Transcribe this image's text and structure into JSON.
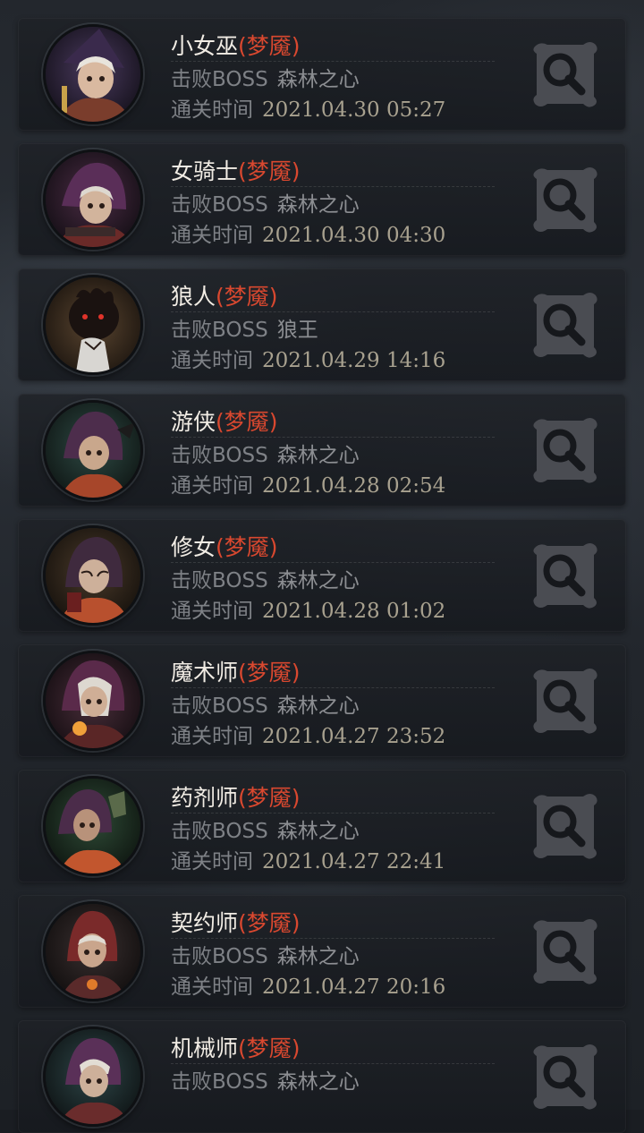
{
  "difficulty_label": "(梦魇)",
  "boss_label": "击败BOSS",
  "time_label": "通关时间",
  "records": [
    {
      "character": "小女巫",
      "boss": "森林之心",
      "time": "2021.04.30 05:27",
      "portrait": "little-witch-portrait"
    },
    {
      "character": "女骑士",
      "boss": "森林之心",
      "time": "2021.04.30 04:30",
      "portrait": "female-knight-portrait"
    },
    {
      "character": "狼人",
      "boss": "狼王",
      "time": "2021.04.29 14:16",
      "portrait": "werewolf-portrait"
    },
    {
      "character": "游侠",
      "boss": "森林之心",
      "time": "2021.04.28 02:54",
      "portrait": "ranger-portrait"
    },
    {
      "character": "修女",
      "boss": "森林之心",
      "time": "2021.04.28 01:02",
      "portrait": "nun-portrait"
    },
    {
      "character": "魔术师",
      "boss": "森林之心",
      "time": "2021.04.27 23:52",
      "portrait": "magician-portrait"
    },
    {
      "character": "药剂师",
      "boss": "森林之心",
      "time": "2021.04.27 22:41",
      "portrait": "alchemist-portrait"
    },
    {
      "character": "契约师",
      "boss": "森林之心",
      "time": "2021.04.27 20:16",
      "portrait": "contractor-portrait"
    },
    {
      "character": "机械师",
      "boss": "森林之心",
      "time": "",
      "portrait": "mechanic-portrait"
    }
  ]
}
